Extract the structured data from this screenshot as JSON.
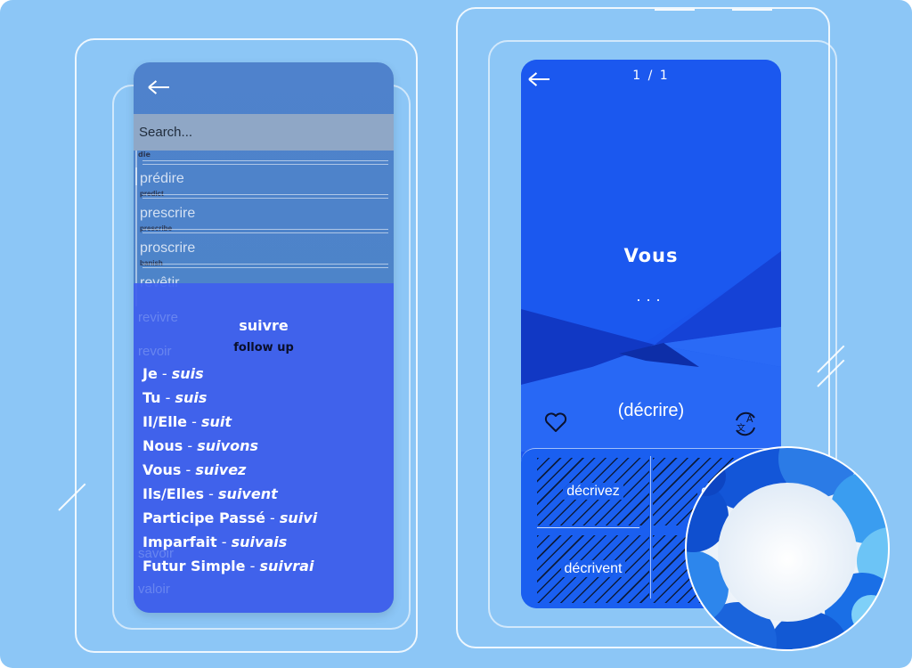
{
  "colors": {
    "background": "#8cc6f6",
    "left_phone": "#4f82cc",
    "conjugation_panel": "#3f60ee",
    "right_phone": "#1b56ee"
  },
  "left_screen": {
    "back_icon": "arrow-left-icon",
    "search": {
      "placeholder": "Search...",
      "value": ""
    },
    "top_partial_translation": "die",
    "word_list": [
      {
        "word": "prédire",
        "translation": "predict"
      },
      {
        "word": "prescrire",
        "translation": "prescribe"
      },
      {
        "word": "proscrire",
        "translation": "banish"
      },
      {
        "word": "revêtir",
        "translation": ""
      }
    ],
    "background_words": [
      "revivre",
      "revoir",
      "savoir",
      "valoir"
    ],
    "conjugation": {
      "verb": "suivre",
      "translation": "follow up",
      "rows": [
        {
          "label": "Je",
          "form": "suis"
        },
        {
          "label": "Tu",
          "form": "suis"
        },
        {
          "label": "Il/Elle",
          "form": "suit"
        },
        {
          "label": "Nous",
          "form": "suivons"
        },
        {
          "label": "Vous",
          "form": "suivez"
        },
        {
          "label": "Ils/Elles",
          "form": "suivent"
        },
        {
          "label": "Participe Passé",
          "form": "suivi"
        },
        {
          "label": "Imparfait",
          "form": "suivais"
        },
        {
          "label": "Futur Simple",
          "form": "suivrai"
        }
      ]
    }
  },
  "right_screen": {
    "back_icon": "arrow-left-icon",
    "counter": "1 / 1",
    "pronoun": "Vous",
    "ellipsis": "...",
    "infinitive": "(décrire)",
    "favorite_icon": "heart-icon",
    "translate_icon": "translate-icon",
    "answers": [
      "décrivez",
      "dé",
      "décrivent",
      "d"
    ]
  }
}
